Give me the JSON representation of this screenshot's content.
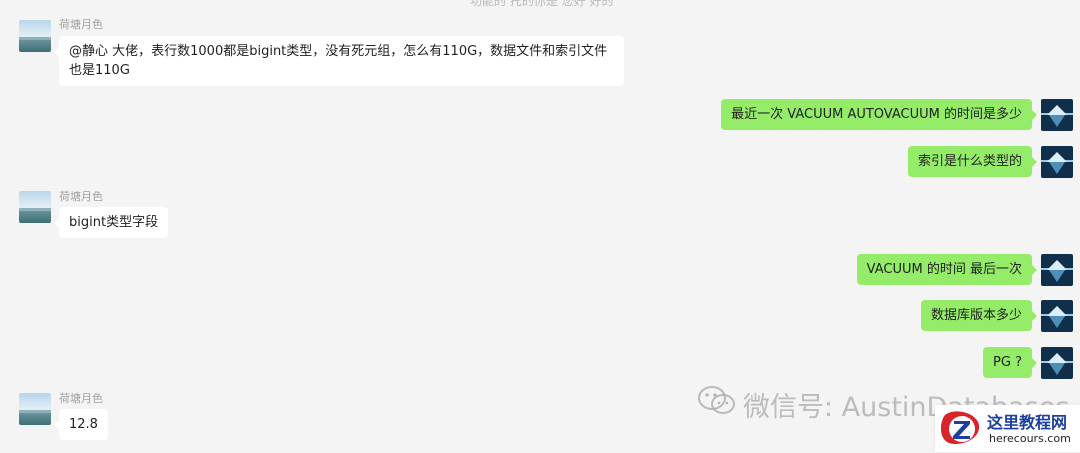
{
  "chat": {
    "top_partial": "功能的 托的你是 您好 好的",
    "messages": [
      {
        "sender": "荷塘月色",
        "text": "@静心 大佬，表行数1000都是bigint类型，没有死元组，怎么有110G，数据文件和索引文件也是110G"
      },
      {
        "text": "最近一次 VACUUM AUTOVACUUM 的时间是多少"
      },
      {
        "text": "索引是什么类型的"
      },
      {
        "sender": "荷塘月色",
        "text": "bigint类型字段"
      },
      {
        "text": "VACUUM 的时间 最后一次"
      },
      {
        "text": "数据库版本多少"
      },
      {
        "text": "PG ?"
      },
      {
        "sender": "荷塘月色",
        "text": "12.8"
      }
    ]
  },
  "watermark": {
    "text": "微信号: AustinDatabases",
    "icon": "wechat-icon"
  },
  "site_logo": {
    "title": "这里教程网",
    "url": "herecours.com",
    "icon": "z-logo-icon"
  },
  "colors": {
    "background": "#f4f4f4",
    "incoming_bubble": "#ffffff",
    "outgoing_bubble": "#95ec69",
    "sender_name": "#a0a0a0"
  }
}
